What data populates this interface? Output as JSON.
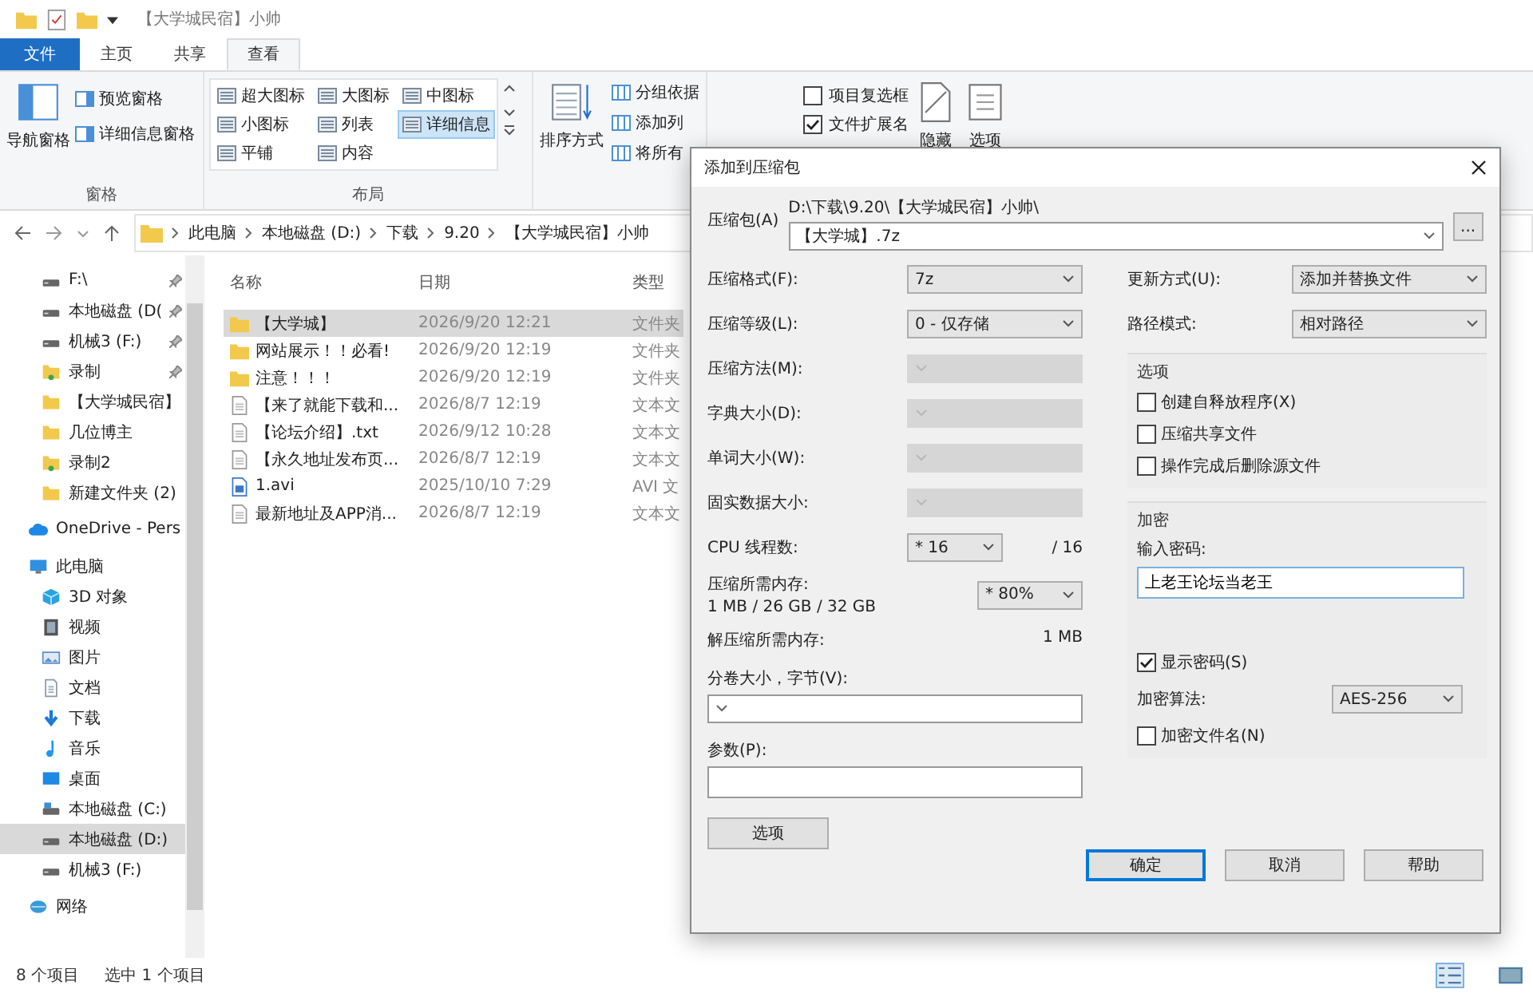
{
  "window": {
    "title": "【大学城民宿】小帅"
  },
  "ribbon": {
    "tabs": [
      {
        "label": "文件",
        "kind": "file",
        "selected": false
      },
      {
        "label": "主页",
        "kind": "tab",
        "selected": false
      },
      {
        "label": "共享",
        "kind": "tab",
        "selected": false
      },
      {
        "label": "查看",
        "kind": "tab",
        "selected": true
      }
    ],
    "panes": {
      "label": "窗格",
      "big": "导航窗格",
      "items": [
        "预览窗格",
        "详细信息窗格"
      ]
    },
    "layout": {
      "label": "布局",
      "options": [
        {
          "label": "超大图标",
          "selected": false
        },
        {
          "label": "大图标",
          "selected": false
        },
        {
          "label": "中图标",
          "selected": false
        },
        {
          "label": "小图标",
          "selected": false
        },
        {
          "label": "列表",
          "selected": false
        },
        {
          "label": "详细信息",
          "selected": true
        },
        {
          "label": "平铺",
          "selected": false
        },
        {
          "label": "内容",
          "selected": false
        }
      ]
    },
    "view": {
      "big": "排序方式",
      "items": [
        "分组依据",
        "添加列",
        "将所有"
      ]
    },
    "show": {
      "checks": [
        {
          "label": "项目复选框",
          "checked": false
        },
        {
          "label": "文件扩展名",
          "checked": true
        }
      ],
      "hide": "隐藏",
      "options": "选项"
    }
  },
  "address": {
    "crumbs": [
      "此电脑",
      "本地磁盘 (D:)",
      "下载",
      "9.20",
      "【大学城民宿】小帅"
    ]
  },
  "sidebar": {
    "quick_access": [
      {
        "label": "F:\\",
        "kind": "drive",
        "pinned": true,
        "selected": false
      },
      {
        "label": "本地磁盘 (D(",
        "kind": "drive",
        "pinned": true,
        "selected": false
      },
      {
        "label": "机械3 (F:)",
        "kind": "drive",
        "pinned": true,
        "selected": false
      },
      {
        "label": "录制",
        "kind": "user",
        "pinned": true,
        "selected": false
      },
      {
        "label": "【大学城民宿】",
        "kind": "folder",
        "pinned": false,
        "selected": false
      },
      {
        "label": "几位博主",
        "kind": "folder",
        "pinned": false,
        "selected": false
      },
      {
        "label": "录制2",
        "kind": "user",
        "pinned": false,
        "selected": false
      },
      {
        "label": "新建文件夹 (2)",
        "kind": "folder",
        "pinned": false,
        "selected": false
      }
    ],
    "items": [
      {
        "label": "OneDrive - Pers",
        "kind": "cloud",
        "selected": false
      },
      {
        "label": "此电脑",
        "kind": "pc",
        "selected": false,
        "children": [
          {
            "label": "3D 对象",
            "kind": "cube",
            "selected": false
          },
          {
            "label": "视频",
            "kind": "video",
            "selected": false
          },
          {
            "label": "图片",
            "kind": "picture",
            "selected": false
          },
          {
            "label": "文档",
            "kind": "document",
            "selected": false
          },
          {
            "label": "下载",
            "kind": "download",
            "selected": false
          },
          {
            "label": "音乐",
            "kind": "music",
            "selected": false
          },
          {
            "label": "桌面",
            "kind": "desktop",
            "selected": false
          },
          {
            "label": "本地磁盘 (C:)",
            "kind": "system",
            "selected": false
          },
          {
            "label": "本地磁盘 (D:)",
            "kind": "drive",
            "selected": true
          },
          {
            "label": "机械3 (F:)",
            "kind": "drive",
            "selected": false
          }
        ]
      },
      {
        "label": "网络",
        "kind": "network",
        "selected": false
      }
    ]
  },
  "files": {
    "columns": [
      "名称",
      "日期",
      "类型"
    ],
    "rows": [
      {
        "name": "【大学城】",
        "date": "2026/9/20 12:21",
        "type": "文件夹",
        "kind": "folder",
        "selected": true
      },
      {
        "name": "网站展示！！必看!",
        "date": "2026/9/20 12:19",
        "type": "文件夹",
        "kind": "folder",
        "selected": false
      },
      {
        "name": "注意！！！",
        "date": "2026/9/20 12:19",
        "type": "文件夹",
        "kind": "folder",
        "selected": false
      },
      {
        "name": "【来了就能下载和...",
        "date": "2026/8/7 12:19",
        "type": "文本文",
        "kind": "text",
        "selected": false
      },
      {
        "name": "【论坛介绍】.txt",
        "date": "2026/9/12 10:28",
        "type": "文本文",
        "kind": "text",
        "selected": false
      },
      {
        "name": "【永久地址发布页...",
        "date": "2026/8/7 12:19",
        "type": "文本文",
        "kind": "text",
        "selected": false
      },
      {
        "name": "1.avi",
        "date": "2025/10/10 7:29",
        "type": "AVI 文",
        "kind": "video",
        "selected": false
      },
      {
        "name": "最新地址及APP消...",
        "date": "2026/8/7 12:19",
        "type": "文本文",
        "kind": "text",
        "selected": false
      }
    ]
  },
  "status_bar": {
    "count": "8 个项目",
    "selection": "选中 1 个项目"
  },
  "dialog": {
    "title": "添加到压缩包",
    "archive_label": "压缩包(A)",
    "archive_path": "D:\\下载\\9.20\\【大学城民宿】小帅\\",
    "archive_name": "【大学城】.7z",
    "browse": "...",
    "rows": [
      {
        "label": "压缩格式(F):",
        "value": "7z",
        "disabled": false
      },
      {
        "label": "压缩等级(L):",
        "value": "0 - 仅存储",
        "disabled": false
      },
      {
        "label": "压缩方法(M):",
        "disabled": true
      },
      {
        "label": "字典大小(D):",
        "disabled": true
      },
      {
        "label": "单词大小(W):",
        "disabled": true
      },
      {
        "label": "固实数据大小:",
        "disabled": true
      }
    ],
    "cpu": {
      "label": "CPU 线程数:",
      "value": "* 16",
      "total": "/ 16"
    },
    "memory": {
      "label": "压缩所需内存:",
      "detail": "1 MB / 26 GB / 32 GB",
      "value": "* 80%"
    },
    "decompress": {
      "label": "解压缩所需内存:",
      "value": "1 MB"
    },
    "volume_label": "分卷大小，字节(V):",
    "params_label": "参数(P):",
    "options_button": "选项",
    "update": {
      "label": "更新方式(U):",
      "value": "添加并替换文件"
    },
    "path_mode": {
      "label": "路径模式:",
      "value": "相对路径"
    },
    "options": {
      "title": "选项",
      "checks": [
        {
          "label": "创建自释放程序(X)",
          "checked": false
        },
        {
          "label": "压缩共享文件",
          "checked": false
        },
        {
          "label": "操作完成后删除源文件",
          "checked": false
        }
      ]
    },
    "encryption": {
      "title": "加密",
      "password_label": "输入密码:",
      "password": "上老王论坛当老王",
      "show_password": {
        "label": "显示密码(S)",
        "checked": true
      },
      "method_label": "加密算法:",
      "method": "AES-256",
      "encrypt_names": {
        "label": "加密文件名(N)",
        "checked": false
      }
    },
    "buttons": [
      {
        "label": "确定",
        "selected": true
      },
      {
        "label": "取消",
        "selected": false
      },
      {
        "label": "帮助",
        "selected": false
      }
    ]
  }
}
